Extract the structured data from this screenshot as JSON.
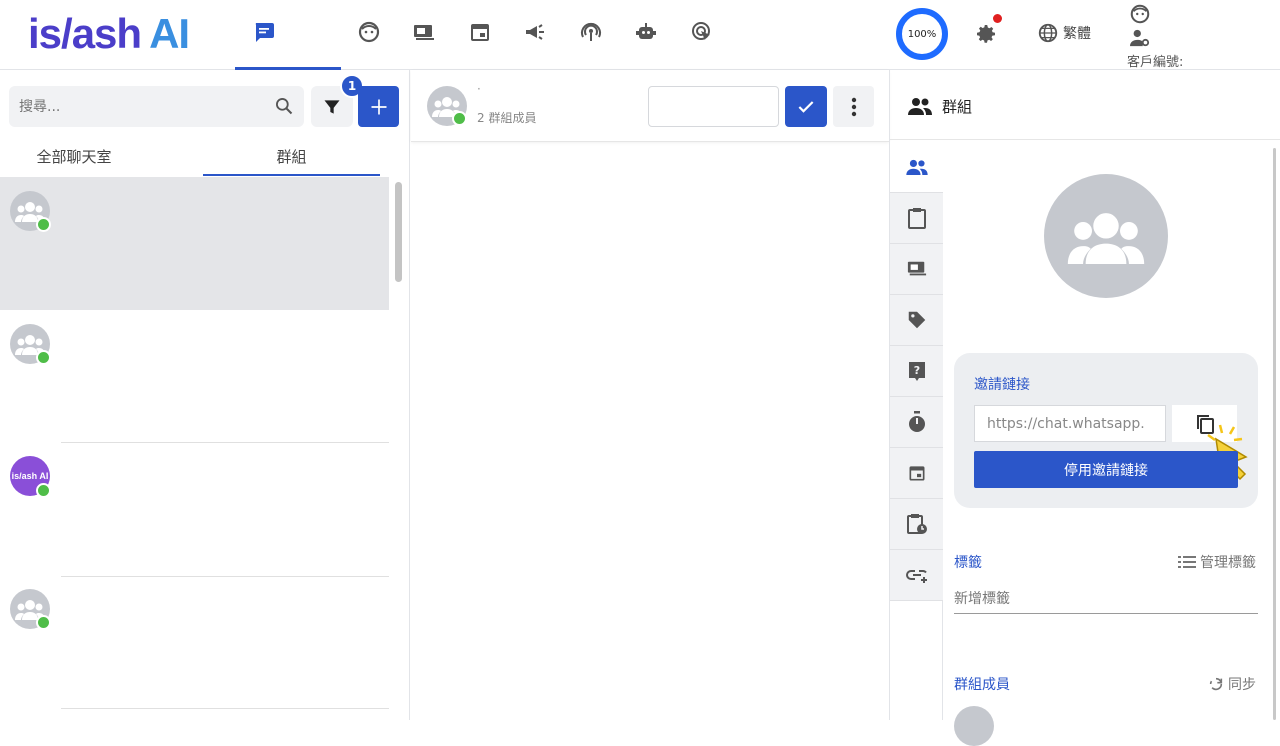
{
  "brand": {
    "logo_text_a": "is/ash",
    "logo_text_b": "AI"
  },
  "topbar": {
    "icons": [
      "chat-icon",
      "face-icon",
      "media-icon",
      "calendar-icon",
      "broadcast-icon",
      "podcast-icon",
      "bot-icon",
      "click-icon"
    ],
    "progress": "100%",
    "language": "繁體",
    "customer_label": "客戶編號:"
  },
  "left": {
    "search_placeholder": "搜尋...",
    "filter_badge": "1",
    "add_label": "+",
    "tabs": [
      "全部聊天室",
      "群組"
    ],
    "active_tab": 1,
    "chats": [
      {
        "avatar": "group",
        "brand_text": ""
      },
      {
        "avatar": "group",
        "brand_text": ""
      },
      {
        "avatar": "brand",
        "brand_text": "is/ash AI"
      },
      {
        "avatar": "group",
        "brand_text": ""
      }
    ]
  },
  "middle": {
    "title": "·",
    "members_count": "2 群組成員"
  },
  "right": {
    "header_title": "群組",
    "invite_label": "邀請鏈接",
    "invite_url": "https://chat.whatsapp.",
    "disable_label": "停用邀請鏈接",
    "tags_title": "標籤",
    "manage_tags": "管理標籤",
    "tag_placeholder": "新增標籤",
    "members_title": "群組成員",
    "sync_label": "同步"
  },
  "colors": {
    "accent": "#2b56c9",
    "whatsapp": "#4fbd48",
    "progress_ring": "#1e6bff"
  }
}
